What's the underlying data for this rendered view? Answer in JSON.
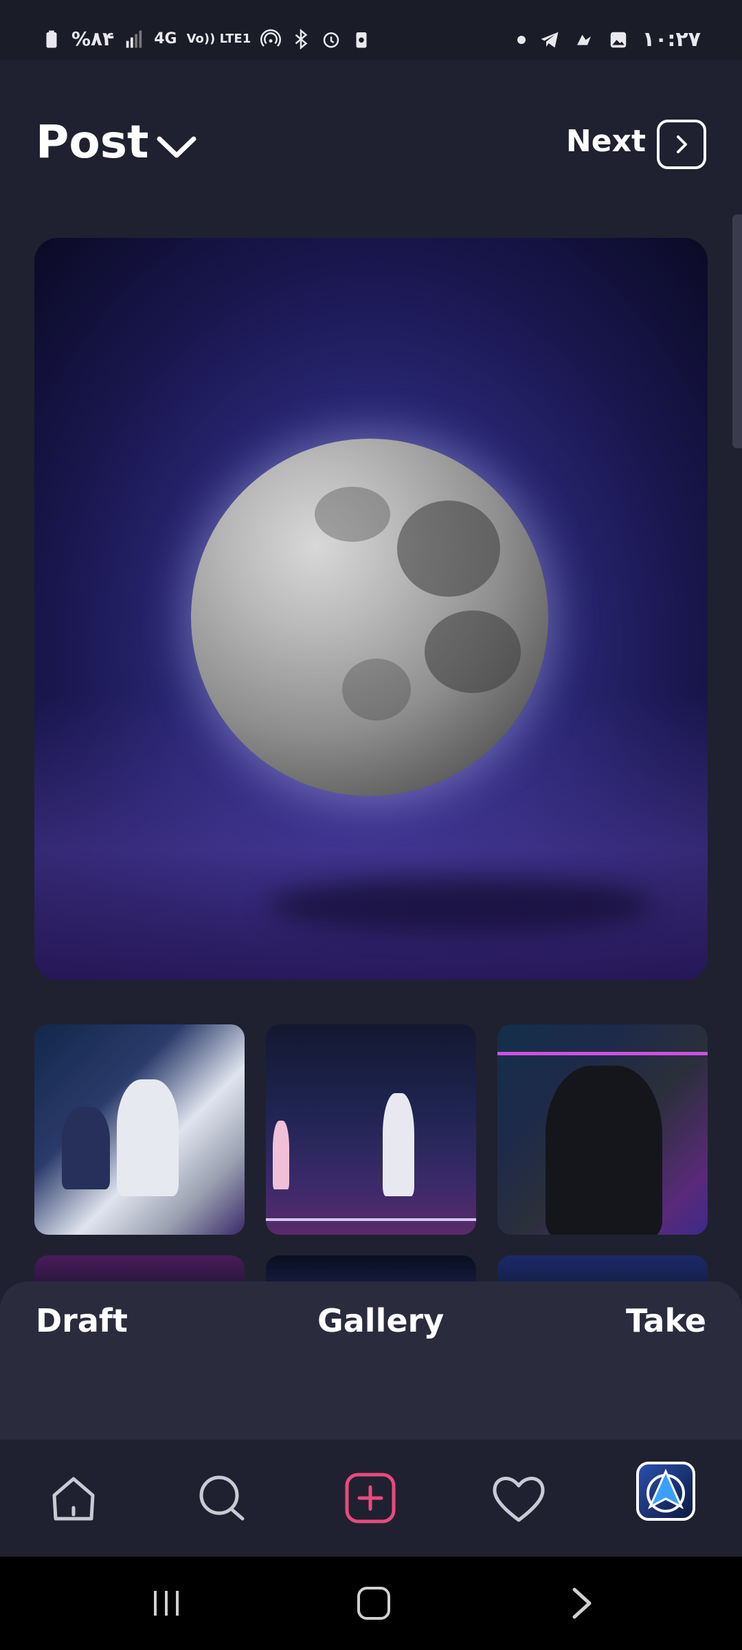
{
  "status_bar": {
    "battery": "%۸۴",
    "network": "4G",
    "volte": "Vo)) LTE1",
    "time": "۱۰:۲۷"
  },
  "header": {
    "title": "Post",
    "next_label": "Next"
  },
  "tabs": {
    "draft": "Draft",
    "gallery": "Gallery",
    "take": "Take"
  },
  "icons": {
    "title_dropdown": "chevron-down-icon",
    "next": "chevron-right-icon",
    "nav": [
      "home-icon",
      "search-icon",
      "add-post-icon",
      "heart-icon",
      "profile-avatar"
    ],
    "system": [
      "recent-apps-icon",
      "home-button-icon",
      "back-icon"
    ]
  },
  "colors": {
    "background": "#1f2130",
    "sheet": "#2a2c3e",
    "accent_add": "#e84a7f",
    "system_nav": "#000000"
  }
}
